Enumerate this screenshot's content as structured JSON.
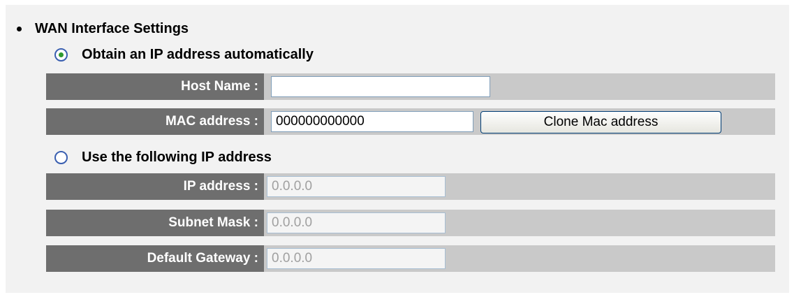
{
  "section": {
    "title": "WAN Interface Settings"
  },
  "auto_option": {
    "label": "Obtain an IP address automatically",
    "selected": true,
    "host_name": {
      "label": "Host Name :",
      "value": ""
    },
    "mac_address": {
      "label": "MAC address :",
      "value": "000000000000",
      "clone_button": "Clone Mac address"
    }
  },
  "static_option": {
    "label": "Use the following IP address",
    "selected": false,
    "ip_address": {
      "label": "IP address :",
      "value": "0.0.0.0"
    },
    "subnet_mask": {
      "label": "Subnet Mask :",
      "value": "0.0.0.0"
    },
    "default_gateway": {
      "label": "Default Gateway :",
      "value": "0.0.0.0"
    }
  },
  "colors": {
    "label_cell_bg": "#6e6e6e",
    "row_bg": "#c9c9c9",
    "panel_bg": "#f2f2f2",
    "radio_selected": "#2f9a2f"
  }
}
